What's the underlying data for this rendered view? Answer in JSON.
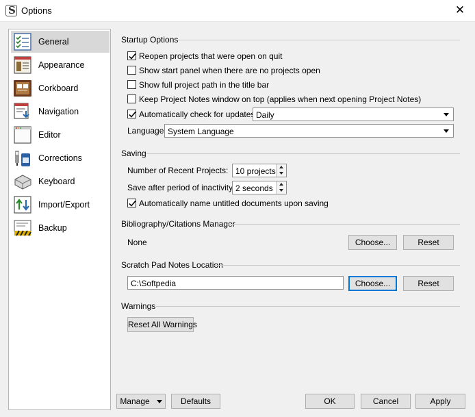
{
  "window": {
    "title": "Options",
    "close_glyph": "✕"
  },
  "sidebar": {
    "items": [
      {
        "label": "General",
        "icon": "checklist-icon",
        "active": true
      },
      {
        "label": "Appearance",
        "icon": "appearance-icon"
      },
      {
        "label": "Corkboard",
        "icon": "corkboard-icon"
      },
      {
        "label": "Navigation",
        "icon": "navigation-icon"
      },
      {
        "label": "Editor",
        "icon": "editor-icon"
      },
      {
        "label": "Corrections",
        "icon": "corrections-icon"
      },
      {
        "label": "Keyboard",
        "icon": "keyboard-icon"
      },
      {
        "label": "Import/Export",
        "icon": "import-export-icon"
      },
      {
        "label": "Backup",
        "icon": "backup-icon"
      }
    ]
  },
  "startup": {
    "title": "Startup Options",
    "reopen": {
      "label": "Reopen projects that were open on quit",
      "checked": true
    },
    "start_panel": {
      "label": "Show start panel when there are no projects open",
      "checked": false
    },
    "full_path": {
      "label": "Show full project path in the title bar",
      "checked": false
    },
    "notes_on_top": {
      "label": "Keep Project Notes window on top (applies when next opening Project Notes)",
      "checked": false
    },
    "auto_update": {
      "label": "Automatically check for updates:",
      "checked": true,
      "value": "Daily"
    },
    "language": {
      "label": "Language:",
      "value": "System Language"
    }
  },
  "saving": {
    "title": "Saving",
    "recent": {
      "label": "Number of Recent Projects:",
      "value": "10 projects"
    },
    "inactivity": {
      "label": "Save after period of inactivity:",
      "value": "2 seconds"
    },
    "auto_name": {
      "label": "Automatically name untitled documents upon saving",
      "checked": true
    }
  },
  "bibliography": {
    "title": "Bibliography/Citations Manager",
    "value": "None",
    "choose_label": "Choose...",
    "reset_label": "Reset"
  },
  "scratch": {
    "title": "Scratch Pad Notes Location",
    "path": "C:\\Softpedia",
    "choose_label": "Choose...",
    "reset_label": "Reset"
  },
  "warnings": {
    "title": "Warnings",
    "reset_all_label": "Reset All Warnings"
  },
  "footer": {
    "manage_label": "Manage",
    "defaults_label": "Defaults",
    "ok_label": "OK",
    "cancel_label": "Cancel",
    "apply_label": "Apply"
  },
  "colors": {
    "accent": "#0078d7",
    "sidebar_selected": "#d8d8d8",
    "background": "#f0f0f0"
  }
}
